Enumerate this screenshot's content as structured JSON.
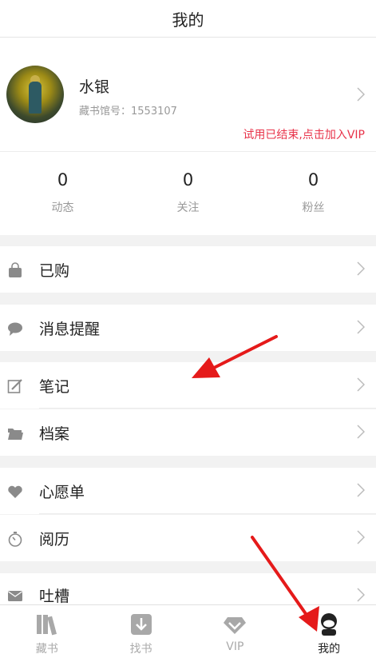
{
  "header": {
    "title": "我的"
  },
  "profile": {
    "name": "水银",
    "library_no": "藏书馆号：1553107",
    "vip_notice": "试用已结束,点击加入VIP"
  },
  "stats": [
    {
      "value": "0",
      "label": "动态"
    },
    {
      "value": "0",
      "label": "关注"
    },
    {
      "value": "0",
      "label": "粉丝"
    }
  ],
  "menu": {
    "purchased": "已购",
    "messages": "消息提醒",
    "notes": "笔记",
    "archive": "档案",
    "wishlist": "心愿单",
    "history": "阅历",
    "feedback": "吐槽"
  },
  "tabs": [
    {
      "label": "藏书"
    },
    {
      "label": "找书"
    },
    {
      "label": "VIP"
    },
    {
      "label": "我的"
    }
  ],
  "colors": {
    "vip_notice": "#e8334a",
    "annotation_arrow": "#e51a1a",
    "icon_gray": "#8a8a8a"
  }
}
